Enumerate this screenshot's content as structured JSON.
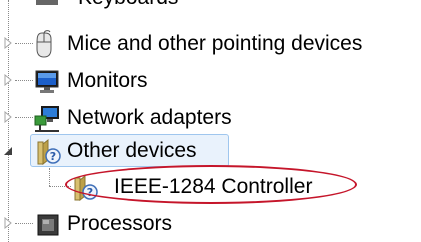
{
  "tree": {
    "partial_item": {
      "label": "Keyboards",
      "icon": "keyboard-icon"
    },
    "items": [
      {
        "label": "Mice and other pointing devices",
        "icon": "mouse-icon",
        "expanded": false
      },
      {
        "label": "Monitors",
        "icon": "monitor-icon",
        "expanded": false
      },
      {
        "label": "Network adapters",
        "icon": "network-adapter-icon",
        "expanded": false
      },
      {
        "label": "Other devices",
        "icon": "unknown-device-icon",
        "expanded": true,
        "selected": true,
        "children": [
          {
            "label": "IEEE-1284 Controller",
            "icon": "unknown-device-icon",
            "highlighted": true
          }
        ]
      },
      {
        "label": "Processors",
        "icon": "processor-icon",
        "expanded": false
      }
    ]
  },
  "colors": {
    "selection_fill": "#e9f2fc",
    "selection_border": "#9fc6ee",
    "annotation_circle": "#c5152a"
  }
}
